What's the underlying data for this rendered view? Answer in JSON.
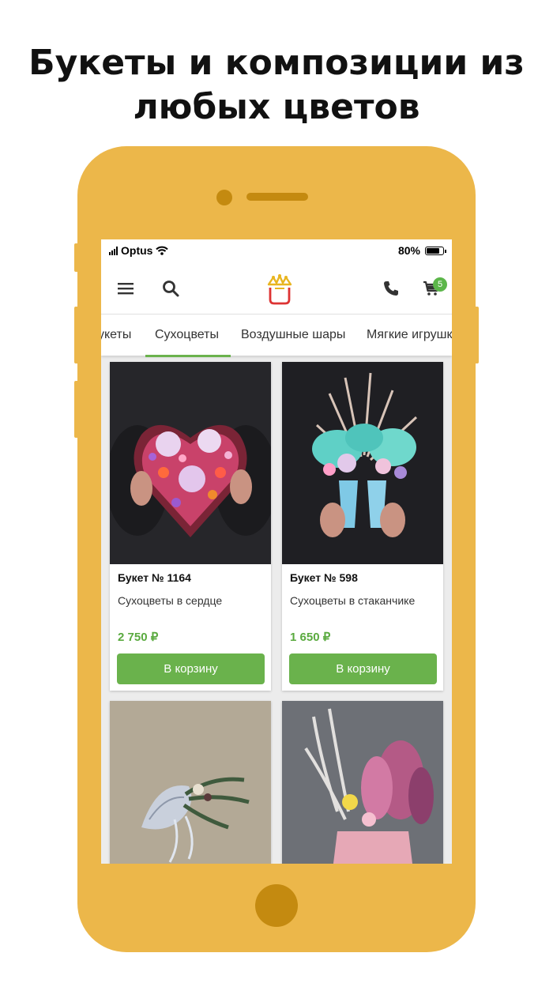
{
  "headline": {
    "line1": "Букеты и композиции из",
    "line2": "любых цветов"
  },
  "statusbar": {
    "carrier": "Optus",
    "battery": "80%"
  },
  "appbar": {
    "cart_count": "5"
  },
  "tabs": [
    {
      "label": "укеты",
      "selected": false
    },
    {
      "label": "Сухоцветы",
      "selected": true
    },
    {
      "label": "Воздушные шары",
      "selected": false
    },
    {
      "label": "Мягкие игрушки",
      "selected": false
    }
  ],
  "products": [
    {
      "title": "Букет № 1164",
      "description": "Сухоцветы в сердце",
      "price": "2 750 ₽",
      "button": "В корзину"
    },
    {
      "title": "Букет № 598",
      "description": "Сухоцветы в стаканчике",
      "price": "1 650 ₽",
      "button": "В корзину"
    }
  ],
  "colors": {
    "phone_body": "#ecb74a",
    "accent_green": "#6ab24c",
    "price_green": "#5aaa3f"
  }
}
